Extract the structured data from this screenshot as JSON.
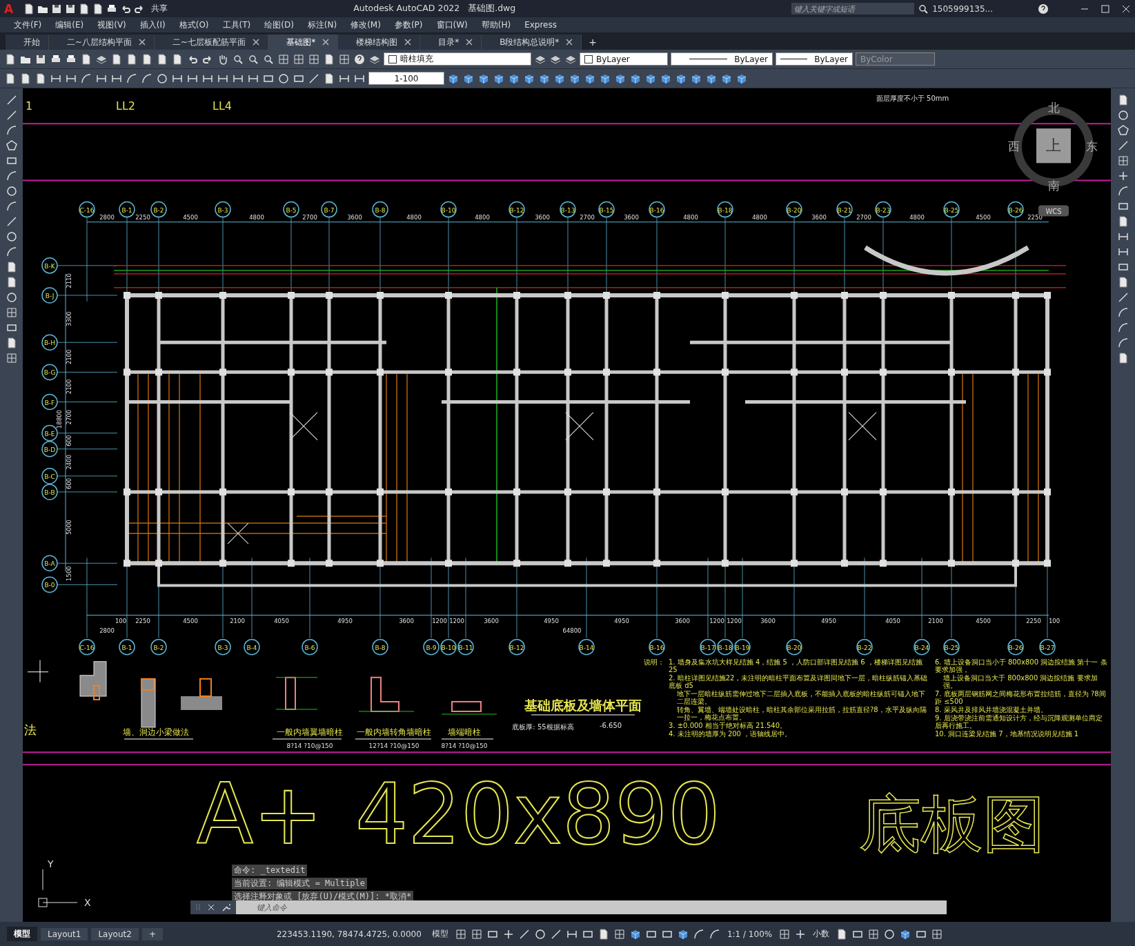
{
  "title_bar": {
    "logo": "A",
    "share": "共享",
    "app_title": "Autodesk AutoCAD 2022",
    "file": "基础图.dwg",
    "search_placeholder": "键入关键字或短语",
    "user": "1505999135..."
  },
  "menu": [
    "文件(F)",
    "编辑(E)",
    "视图(V)",
    "插入(I)",
    "格式(O)",
    "工具(T)",
    "绘图(D)",
    "标注(N)",
    "修改(M)",
    "参数(P)",
    "窗口(W)",
    "帮助(H)",
    "Express"
  ],
  "tabs": [
    {
      "label": "开始",
      "selected": false,
      "closable": false
    },
    {
      "label": "二~八层结构平面",
      "selected": false,
      "closable": true
    },
    {
      "label": "二~七层板配筋平面",
      "selected": false,
      "closable": true
    },
    {
      "label": "基础图*",
      "selected": true,
      "closable": true
    },
    {
      "label": "楼梯结构图",
      "selected": false,
      "closable": true
    },
    {
      "label": "目录*",
      "selected": false,
      "closable": true
    },
    {
      "label": "B段结构总说明*",
      "selected": false,
      "closable": true
    }
  ],
  "new_tab": "+",
  "properties": {
    "layer": "暗柱填充",
    "object_colour": "ByLayer",
    "linetype": "ByLayer",
    "lineweight": "ByLayer",
    "plot_style": "ByColor",
    "scale": "1-100"
  },
  "drawing": {
    "top_labels": [
      "1",
      "LL2",
      "LL4"
    ],
    "top_note": "面层厚度不小于 50mm",
    "top_axes": [
      "C-16",
      "B-1",
      "B-2",
      "B-3",
      "B-5",
      "B-7",
      "B-8",
      "B-10",
      "B-12",
      "B-13",
      "B-15",
      "B-16",
      "B-18",
      "B-20",
      "B-21",
      "B-23",
      "B-25",
      "B-26"
    ],
    "top_dims": [
      "2800",
      "2250",
      "4500",
      "4800",
      "2700",
      "3600",
      "4800",
      "4800",
      "3600",
      "2700",
      "3600",
      "4800",
      "4800",
      "3600",
      "2700",
      "4800",
      "4500",
      "2250"
    ],
    "bottom_axes": [
      "C-16",
      "B-1",
      "B-2",
      "B-3",
      "B-4",
      "B-6",
      "B-8",
      "B-9",
      "B-10",
      "B-11",
      "B-12",
      "B-14",
      "B-16",
      "B-17",
      "B-18",
      "B-19",
      "B-20",
      "B-22",
      "B-24",
      "B-25",
      "B-26",
      "B-27"
    ],
    "bottom_dims": [
      "100",
      "2250",
      "4500",
      "2100",
      "4050",
      "4950",
      "3600",
      "1200",
      "1200",
      "3600",
      "4950",
      "4950",
      "3600",
      "1200",
      "1200",
      "3600",
      "4950",
      "4050",
      "2100",
      "4500",
      "2250",
      "100"
    ],
    "bottom_totals": [
      "2800",
      "64800"
    ],
    "left_axes": [
      "B-K",
      "B-J",
      "B-H",
      "B-G",
      "B-F",
      "B-E",
      "B-D",
      "B-C",
      "B-B",
      "B-A",
      "B-0"
    ],
    "left_dims": [
      "2110",
      "3300",
      "2100",
      "2100",
      "2700",
      "600",
      "2400",
      "600",
      "5000",
      "1500"
    ],
    "left_total": "18800",
    "details": [
      {
        "title": "墙、洞边小梁做法"
      },
      {
        "title": "一般内墙翼墙暗柱",
        "rebar": "8?14  ?10@150"
      },
      {
        "title": "一般内墙转角墙暗柱",
        "rebar": "12?14  ?10@150"
      },
      {
        "title": "墙端暗柱",
        "rebar": "8?14  ?10@150"
      }
    ],
    "detail_side_label": "法",
    "plan_title": "基础底板及墙体平面",
    "plan_subtitle": "底板厚: 55根据标高",
    "plan_level": "-6.650",
    "notes_label": "说明：",
    "notes": [
      "1. 墙身及集水坑大样见结施 4，结施 5 ，人防口部详图见结施 6 ，楼梯详图见结施 25",
      "2. 暗柱详图见结施22，未注明的暗柱平面布置及详图同地下一层，暗柱纵筋锚入基础底板 d5",
      "地下一层暗柱纵筋需伸过地下二层插入底板，不能插入底板的暗柱纵筋可锚入地下二层连梁。",
      "转角、翼墙、端墙处设暗柱，暗柱其余部位采用拉筋，拉筋直径?8，水平及纵向隔一拉一，梅花点布置。",
      "3. ±0.000 相当于绝对标高 21.540。",
      "4. 未注明的墙厚为 200 ，语轴线居中。",
      "6. 墙上设备洞口当小于 800x800 洞边按结施 第十一 条要求加强，",
      "墙上设备洞口当大于 800x800 洞边按结施 要求加强。",
      "7. 底板两层钢筋网之间梅花形布置拉结筋，直径为 ?8间距 ≤500",
      "8. 采风井及排风井墙浇混凝土并墙。",
      "9. 后浇带浇注前需通知设计方，经与沉降观测单位商定后再行施工。",
      "10. 洞口连梁见结施 7，地基情况说明见结施 1"
    ],
    "big_text": [
      "A+",
      "420x890",
      "底板图"
    ]
  },
  "compass": {
    "north": "北",
    "west": "西",
    "east": "东",
    "south": "南",
    "top": "上",
    "ucs": "WCS"
  },
  "ucs_axes": [
    "Y",
    "X"
  ],
  "command": {
    "history": [
      "命令: _textedit",
      "当前设置: 编辑模式 = Multiple",
      "选择注释对象或 [放弃(U)/模式(M)]: *取消*"
    ],
    "placeholder": "键入命令"
  },
  "layout_tabs": [
    {
      "label": "模型",
      "selected": true
    },
    {
      "label": "Layout1",
      "selected": false
    },
    {
      "label": "Layout2",
      "selected": false
    }
  ],
  "status_bar": {
    "add": "+",
    "coordinates": "223453.1190, 78474.4725, 0.0000",
    "space": "模型",
    "scale": "1:1 / 100%",
    "units": "小数"
  }
}
